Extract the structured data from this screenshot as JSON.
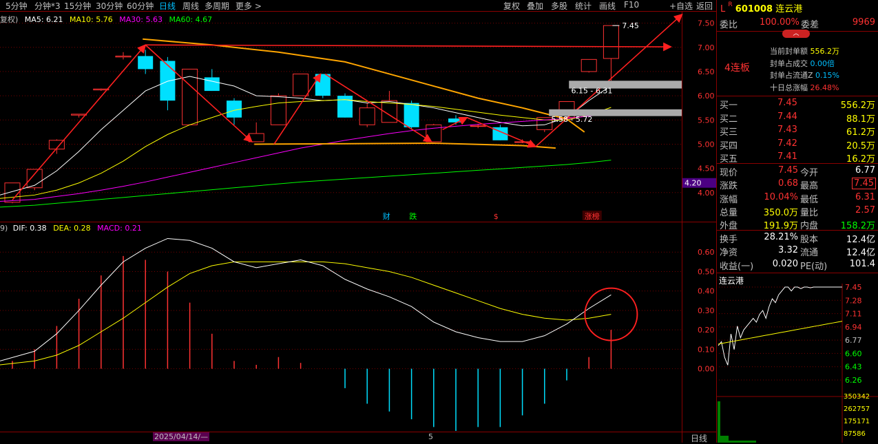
{
  "toolbar": {
    "periods": [
      "5分钟",
      "分钟*3",
      "15分钟",
      "30分钟",
      "60分钟",
      "日线",
      "周线",
      "多周期",
      "更多 >"
    ],
    "active_period": "日线",
    "right_buttons": [
      "复权",
      "叠加",
      "多股",
      "统计",
      "画线",
      "F10",
      "+自选",
      "返回"
    ]
  },
  "chart_data": [
    {
      "type": "candlestick",
      "legend_prefix": "复权)",
      "ma_legend": [
        {
          "name": "MA5",
          "value": "6.21",
          "color": "#ffffff"
        },
        {
          "name": "MA10",
          "value": "5.76",
          "color": "#ffff00"
        },
        {
          "name": "MA30",
          "value": "5.63",
          "color": "#ff00ff"
        },
        {
          "name": "MA60",
          "value": "4.67",
          "color": "#00ff00"
        }
      ],
      "ylim": [
        3.4,
        7.75
      ],
      "yticks": [
        4.0,
        4.5,
        5.0,
        5.5,
        6.0,
        6.5,
        7.0,
        7.5
      ],
      "ytick_labels": [
        "4.00",
        "4.50",
        "5.00",
        "5.50",
        "6.00",
        "6.50",
        "7.00",
        "7.50"
      ],
      "candles": [
        {
          "o": 3.8,
          "h": 4.2,
          "l": 3.78,
          "c": 4.2
        },
        {
          "o": 4.1,
          "h": 4.48,
          "l": 4.05,
          "c": 4.48
        },
        {
          "o": 4.9,
          "h": 5.1,
          "l": 4.8,
          "c": 5.08
        },
        {
          "o": 5.6,
          "h": 5.62,
          "l": 5.55,
          "c": 5.62
        },
        {
          "o": 6.12,
          "h": 6.15,
          "l": 6.1,
          "c": 6.14
        },
        {
          "o": 6.8,
          "h": 6.9,
          "l": 6.75,
          "c": 6.82
        },
        {
          "o": 6.82,
          "h": 6.95,
          "l": 6.45,
          "c": 6.55
        },
        {
          "o": 6.72,
          "h": 6.8,
          "l": 5.7,
          "c": 5.9
        },
        {
          "o": 5.4,
          "h": 6.55,
          "l": 5.4,
          "c": 6.55
        },
        {
          "o": 6.38,
          "h": 6.55,
          "l": 6.1,
          "c": 6.1
        },
        {
          "o": 5.9,
          "h": 5.95,
          "l": 5.4,
          "c": 5.55
        },
        {
          "o": 5.05,
          "h": 5.45,
          "l": 5.05,
          "c": 5.22
        },
        {
          "o": 5.4,
          "h": 6.05,
          "l": 5.4,
          "c": 6.0
        },
        {
          "o": 6.0,
          "h": 6.45,
          "l": 6.0,
          "c": 6.45
        },
        {
          "o": 6.45,
          "h": 6.45,
          "l": 5.95,
          "c": 6.0
        },
        {
          "o": 6.0,
          "h": 6.05,
          "l": 5.55,
          "c": 5.55
        },
        {
          "o": 5.4,
          "h": 5.85,
          "l": 5.35,
          "c": 5.75
        },
        {
          "o": 5.45,
          "h": 6.1,
          "l": 5.45,
          "c": 5.9
        },
        {
          "o": 5.85,
          "h": 5.9,
          "l": 5.3,
          "c": 5.35
        },
        {
          "o": 5.05,
          "h": 5.42,
          "l": 5.05,
          "c": 5.4
        },
        {
          "o": 5.53,
          "h": 5.6,
          "l": 5.4,
          "c": 5.45
        },
        {
          "o": 5.38,
          "h": 5.42,
          "l": 5.33,
          "c": 5.38
        },
        {
          "o": 5.35,
          "h": 5.4,
          "l": 5.08,
          "c": 5.08
        },
        {
          "o": 5.05,
          "h": 5.1,
          "l": 5.02,
          "c": 5.05
        },
        {
          "o": 5.3,
          "h": 5.55,
          "l": 5.25,
          "c": 5.55
        },
        {
          "o": 5.55,
          "h": 5.88,
          "l": 5.55,
          "c": 5.88
        },
        {
          "o": 6.5,
          "h": 6.75,
          "l": 6.48,
          "c": 6.75
        },
        {
          "o": 6.77,
          "h": 7.45,
          "l": 6.31,
          "c": 7.45
        }
      ],
      "ma": {
        "MA5": [
          3.95,
          4.15,
          4.45,
          4.85,
          5.3,
          5.7,
          6.1,
          6.3,
          6.4,
          6.3,
          6.2,
          6.0,
          5.98,
          5.95,
          5.9,
          5.92,
          5.85,
          5.88,
          5.82,
          5.75,
          5.65,
          5.55,
          5.45,
          5.38,
          5.4,
          5.55,
          5.9,
          6.21
        ],
        "MA10": [
          3.88,
          3.95,
          4.05,
          4.2,
          4.4,
          4.65,
          4.95,
          5.2,
          5.4,
          5.55,
          5.7,
          5.78,
          5.85,
          5.88,
          5.9,
          5.92,
          5.88,
          5.85,
          5.82,
          5.78,
          5.72,
          5.66,
          5.6,
          5.55,
          5.5,
          5.5,
          5.6,
          5.76
        ],
        "MA30": [
          3.82,
          3.86,
          3.92,
          3.98,
          4.05,
          4.13,
          4.22,
          4.32,
          4.42,
          4.52,
          4.62,
          4.72,
          4.82,
          4.92,
          5.0,
          5.08,
          5.15,
          5.22,
          5.28,
          5.33,
          5.37,
          5.41,
          5.44,
          5.47,
          5.5,
          5.53,
          5.58,
          5.63
        ],
        "MA60": [
          3.7,
          3.74,
          3.78,
          3.82,
          3.86,
          3.9,
          3.94,
          3.98,
          4.02,
          4.06,
          4.1,
          4.14,
          4.18,
          4.22,
          4.25,
          4.28,
          4.31,
          4.34,
          4.37,
          4.4,
          4.43,
          4.46,
          4.49,
          4.52,
          4.55,
          4.58,
          4.62,
          4.67
        ]
      },
      "annotations": {
        "high_label": "7.45",
        "zone_label_1": "6.15 - 6.31",
        "zone_label_2": "5.58 - 5.72",
        "ma60_price_tag": "4.20",
        "event_labels": [
          "财",
          "跌",
          "$",
          "涨榜"
        ]
      }
    },
    {
      "type": "macd",
      "legend_prefix": "9)",
      "legend": [
        {
          "name": "DIF",
          "value": "0.38",
          "color": "#ffffff"
        },
        {
          "name": "DEA",
          "value": "0.28",
          "color": "#ffff00"
        },
        {
          "name": "MACD",
          "value": "0.21",
          "color": "#ff00ff"
        }
      ],
      "ylim": [
        -0.32,
        0.7
      ],
      "yticks": [
        0.0,
        0.1,
        0.2,
        0.3,
        0.4,
        0.5,
        0.6
      ],
      "ytick_labels": [
        "0.00",
        "0.10",
        "0.20",
        "0.30",
        "0.40",
        "0.50",
        "0.60"
      ],
      "dif": [
        0.04,
        0.09,
        0.18,
        0.3,
        0.43,
        0.55,
        0.62,
        0.67,
        0.66,
        0.62,
        0.55,
        0.52,
        0.54,
        0.56,
        0.53,
        0.46,
        0.41,
        0.37,
        0.32,
        0.24,
        0.19,
        0.16,
        0.14,
        0.14,
        0.17,
        0.23,
        0.31,
        0.38
      ],
      "dea": [
        0.02,
        0.04,
        0.07,
        0.12,
        0.19,
        0.26,
        0.34,
        0.42,
        0.49,
        0.53,
        0.55,
        0.55,
        0.55,
        0.55,
        0.55,
        0.54,
        0.52,
        0.5,
        0.47,
        0.43,
        0.39,
        0.35,
        0.31,
        0.28,
        0.26,
        0.25,
        0.26,
        0.28
      ],
      "macd": [
        0.04,
        0.1,
        0.22,
        0.36,
        0.48,
        0.58,
        0.56,
        0.5,
        0.34,
        0.18,
        0.04,
        0.02,
        0.06,
        0.03,
        0.0,
        -0.1,
        -0.18,
        -0.22,
        -0.26,
        -0.3,
        -0.32,
        -0.3,
        -0.3,
        -0.24,
        -0.18,
        -0.06,
        0.06,
        0.2
      ]
    }
  ],
  "x_axis": {
    "date_label": "2025/04/14/—",
    "marker": "5",
    "period_label": "日线"
  },
  "quote": {
    "code": "601008",
    "name": "连云港",
    "prefix": "L",
    "weibi_label": "委比",
    "weibi": "100.00%",
    "weicha_label": "委差",
    "weicha": "9969",
    "board_label": "4连板",
    "seal_rows": [
      {
        "label": "当前封单额",
        "value": "556.2万"
      },
      {
        "label": "封单占成交",
        "value": "0.00倍"
      },
      {
        "label": "封单占流通Z",
        "value": "0.15%"
      },
      {
        "label": "十日总涨幅",
        "value": "26.48%"
      }
    ],
    "bids": [
      {
        "label": "买一",
        "price": "7.45",
        "vol": "556.2万"
      },
      {
        "label": "买二",
        "price": "7.44",
        "vol": "88.1万"
      },
      {
        "label": "买三",
        "price": "7.43",
        "vol": "61.2万"
      },
      {
        "label": "买四",
        "price": "7.42",
        "vol": "20.5万"
      },
      {
        "label": "买五",
        "price": "7.41",
        "vol": "16.2万"
      }
    ],
    "stats": [
      {
        "l1": "现价",
        "v1": "7.45",
        "l2": "今开",
        "v2": "6.77"
      },
      {
        "l1": "涨跌",
        "v1": "0.68",
        "l2": "最高",
        "v2": "7.45"
      },
      {
        "l1": "涨幅",
        "v1": "10.04%",
        "l2": "最低",
        "v2": "6.31"
      },
      {
        "l1": "总量",
        "v1": "350.0万",
        "l2": "量比",
        "v2": "2.57"
      },
      {
        "l1": "外盘",
        "v1": "191.9万",
        "l2": "内盘",
        "v2": "158.2万"
      }
    ],
    "stats2": [
      {
        "l1": "换手",
        "v1": "28.21%",
        "l2": "股本",
        "v2": "12.4亿"
      },
      {
        "l1": "净资",
        "v1": "3.32",
        "l2": "流通",
        "v2": "12.4亿"
      },
      {
        "l1": "收益(一)",
        "v1": "0.020",
        "l2": "PE(动)",
        "v2": "101.4"
      }
    ]
  },
  "mini_chart": {
    "title": "连云港",
    "price_labels": [
      "7.45",
      "7.28",
      "7.11",
      "6.94",
      "6.77",
      "6.60",
      "6.43",
      "6.26"
    ],
    "volume_labels": [
      "350342",
      "262757",
      "175171",
      "87586"
    ]
  },
  "colors": {
    "up": "#ff3232",
    "down": "#00e0ff",
    "bg": "#000000",
    "grid": "#7a0000"
  }
}
